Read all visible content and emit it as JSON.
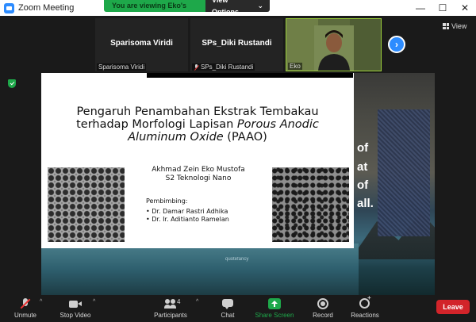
{
  "window": {
    "title": "Zoom Meeting",
    "minimize": "—",
    "maximize": "☐",
    "close": "✕"
  },
  "banner": {
    "viewing": "You are viewing Eko's screen",
    "view_options": "View Options",
    "caret": "⌄"
  },
  "participants_strip": [
    {
      "center_name": "Sparisoma Viridi",
      "corner_name": "Sparisoma Viridi",
      "muted": false,
      "active": false
    },
    {
      "center_name": "SPs_Diki Rustandi",
      "corner_name": "SPs_Diki Rustandi",
      "muted": true,
      "active": false
    },
    {
      "center_name": "",
      "corner_name": "Eko",
      "muted": false,
      "active": true
    }
  ],
  "strip_next": "›",
  "view_label": "View",
  "slide": {
    "title_line1": "Pengaruh Penambahan Ekstrak Tembakau",
    "title_line2": "terhadap Morfologi Lapisan",
    "title_line2_italic": "Porous Anodic",
    "title_line3_italic": "Aluminum Oxide",
    "title_line3_rest": " (PAAO)",
    "author": "Akhmad Zein Eko Mustofa",
    "program": "S2 Teknologi Nano",
    "supervisor_heading": "Pembimbing:",
    "supervisors": [
      "Dr. Damar Rastri Adhika",
      "Dr. Ir. Aditianto Ramelan"
    ]
  },
  "background_text": [
    "of",
    "at",
    "of",
    "all."
  ],
  "watermark": "quotefancy",
  "toolbar": {
    "unmute": "Unmute",
    "stop_video": "Stop Video",
    "participants": "Participants",
    "participants_count": "4",
    "chat": "Chat",
    "share_screen": "Share Screen",
    "record": "Record",
    "reactions": "Reactions",
    "leave": "Leave",
    "caret": "^"
  },
  "colors": {
    "accent_green": "#1ea84a",
    "zoom_blue": "#2d8cff",
    "leave_red": "#d2242a",
    "active_tile_border": "#9bd03a"
  }
}
